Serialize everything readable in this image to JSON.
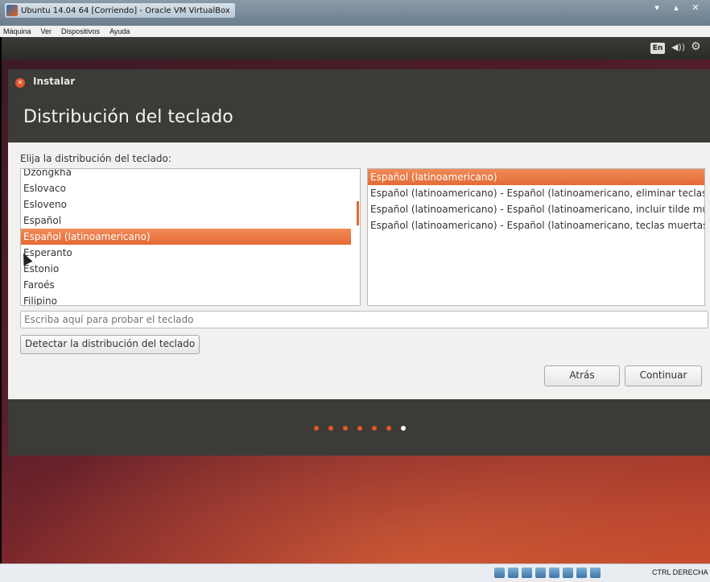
{
  "host": {
    "title": "Ubuntu 14.04 64 [Corriendo] - Oracle VM VirtualBox",
    "menu": [
      "Máquina",
      "Ver",
      "Dispositivos",
      "Ayuda"
    ],
    "status_key": "CTRL DERECHA"
  },
  "panel": {
    "lang": "En",
    "volume_icon": "volume-icon",
    "settings_icon": "gear-icon"
  },
  "installer": {
    "window_title": "Instalar",
    "page_title": "Distribución del teclado",
    "choose_label": "Elija la distribución del teclado:",
    "layouts": [
      {
        "label": "Dzongkha",
        "selected": false
      },
      {
        "label": "Eslovaco",
        "selected": false
      },
      {
        "label": "Esloveno",
        "selected": false
      },
      {
        "label": "Español",
        "selected": false
      },
      {
        "label": "Español (latinoamericano)",
        "selected": true
      },
      {
        "label": "Esperanto",
        "selected": false
      },
      {
        "label": "Estonio",
        "selected": false
      },
      {
        "label": "Faroés",
        "selected": false
      },
      {
        "label": "Filipino",
        "selected": false
      }
    ],
    "variants": [
      {
        "label": "Español (latinoamericano)",
        "selected": true
      },
      {
        "label": "Español (latinoamericano) - Español (latinoamericano, eliminar teclas mu",
        "selected": false
      },
      {
        "label": "Español (latinoamericano) - Español (latinoamericano, incluir tilde muert",
        "selected": false
      },
      {
        "label": "Español (latinoamericano) - Español (latinoamericano, teclas muertas de",
        "selected": false
      }
    ],
    "test_placeholder": "Escriba aquí para probar el teclado",
    "detect_label": "Detectar la distribución del teclado",
    "back_label": "Atrás",
    "continue_label": "Continuar",
    "progress": {
      "total": 7,
      "current": 7
    }
  },
  "colors": {
    "accent": "#e26a31",
    "panel": "#3c3b37"
  }
}
